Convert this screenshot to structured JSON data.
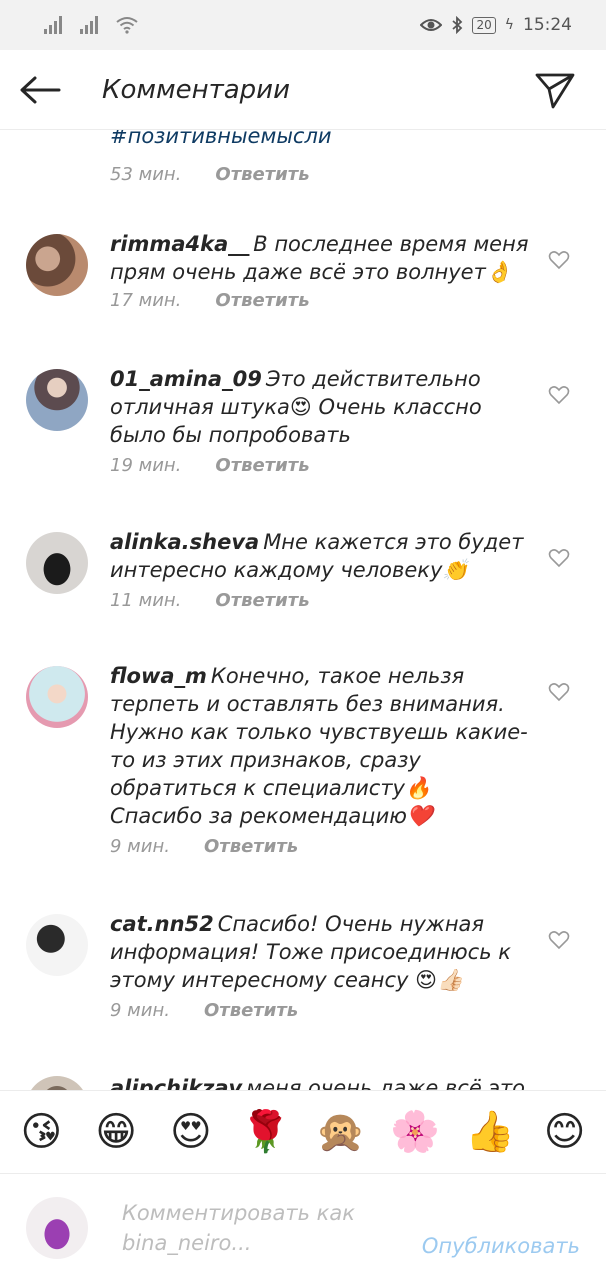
{
  "status": {
    "time": "15:24",
    "battery": "20"
  },
  "header": {
    "title": "Комментарии"
  },
  "top": {
    "tag": "#позитивныемысли",
    "time": "53 мин.",
    "reply": "Ответить"
  },
  "comments": [
    {
      "user": "rimma4ka__",
      "text": "В последнее время меня прям очень даже всё это волнует👌",
      "time": "17 мин.",
      "reply": "Ответить",
      "avatar_colors": [
        "#6b4a3a",
        "#caa58f"
      ]
    },
    {
      "user": "01_amina_09",
      "text": "Это действительно отличная штука😍 Очень классно было бы попробовать",
      "time": "19 мин.",
      "reply": "Ответить",
      "avatar_colors": [
        "#5c4b4f",
        "#b9c7d9"
      ]
    },
    {
      "user": "alinka.sheva",
      "text": "Мне  кажется это будет интересно каждому человеку👏",
      "time": "11 мин.",
      "reply": "Ответить",
      "avatar_colors": [
        "#e8e6e3",
        "#1b1b1b"
      ]
    },
    {
      "user": "flowa_m",
      "text": "Конечно, такое нельзя терпеть и оставлять без внимания. Нужно как только чувствуешь какие-то из этих признаков, сразу обратиться к специалисту🔥 Спасибо за рекомендацию❤️",
      "time": "9 мин.",
      "reply": "Ответить",
      "avatar_colors": [
        "#cfe9ee",
        "#e59ab0"
      ]
    },
    {
      "user": "cat.nn52",
      "text": "Спасибо! Очень нужная информация! Тоже присоединюсь к этому интересному сеансу 😍👍🏻",
      "time": "9 мин.",
      "reply": "Ответить",
      "avatar_colors": [
        "#f4f4f4",
        "#2a2a2a"
      ]
    },
    {
      "user": "alipchikzav",
      "text": "меня очень даже всё это",
      "avatar_colors": [
        "#cfc4b8",
        "#7a6a5c"
      ]
    }
  ],
  "emoji_bar": [
    "😘",
    "😁",
    "😍",
    "🌹",
    "🙊",
    "🌸",
    "👍",
    "😊"
  ],
  "composer": {
    "placeholder": "Комментировать как bina_neiro...",
    "publish": "Опубликовать",
    "avatar_colors": [
      "#f2eef0",
      "#9b3fb2"
    ]
  }
}
